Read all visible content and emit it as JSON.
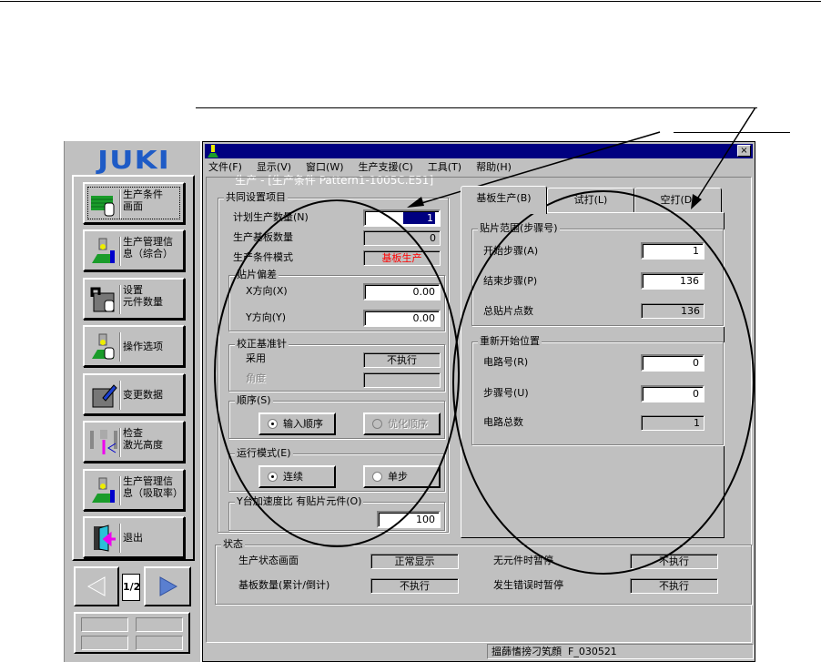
{
  "sidebar": {
    "logo": "JUKI",
    "buttons": [
      {
        "label": "生产条件\n画面",
        "icon": "pcb-hand-icon"
      },
      {
        "label": "生产管理信\n息（综合）",
        "icon": "head-info-icon"
      },
      {
        "label": "设置\n元件数量",
        "icon": "component-count-icon"
      },
      {
        "label": "操作选项",
        "icon": "head-hand-icon"
      },
      {
        "label": "变更数据",
        "icon": "edit-data-icon"
      },
      {
        "label": "检查\n激光高度",
        "icon": "laser-height-icon"
      },
      {
        "label": "生产管理信\n息（吸取率）",
        "icon": "head-info-icon"
      },
      {
        "label": "退出",
        "icon": "exit-door-icon"
      }
    ],
    "page_indicator": "1/2"
  },
  "window": {
    "title": "生产 - [生产条件 Pattern1-1005C.E51]",
    "close": "×",
    "menu": [
      "文件(F)",
      "显示(V)",
      "窗口(W)",
      "生产支援(C)",
      "工具(T)",
      "帮助(H)"
    ]
  },
  "common": {
    "title": "共同设置项目",
    "plan_qty_label": "计划生产数量(N)",
    "plan_qty": "1",
    "board_qty_label": "生产基板数量",
    "board_qty": "0",
    "mode_label": "生产条件模式",
    "mode": "基板生产",
    "offset": {
      "title": "贴片偏差",
      "x_label": "X方向(X)",
      "x": "0.00",
      "y_label": "Y方向(Y)",
      "y": "0.00"
    },
    "pin": {
      "title": "校正基准针",
      "use_label": "采用",
      "use": "不执行",
      "angle_label": "角度",
      "angle": ""
    },
    "order": {
      "title": "顺序(S)",
      "opt1": "输入顺序",
      "opt2": "优化顺序"
    },
    "run": {
      "title": "运行模式(E)",
      "opt1": "连续",
      "opt2": "单步"
    },
    "accel": {
      "title": "Y台加速度比 有贴片元件(O)",
      "value": "100"
    }
  },
  "tabs": [
    "基板生产(B)",
    "试打(L)",
    "空打(D)"
  ],
  "range": {
    "title": "贴片范围(步骤号)",
    "start_label": "开始步骤(A)",
    "start": "1",
    "end_label": "结束步骤(P)",
    "end": "136",
    "total_label": "总贴片点数",
    "total": "136"
  },
  "restart": {
    "title": "重新开始位置",
    "circuit_label": "电路号(R)",
    "circuit": "0",
    "step_label": "步骤号(U)",
    "step": "0",
    "total_label": "电路总数",
    "total": "1"
  },
  "status": {
    "title": "状态",
    "rows": [
      {
        "l1": "生产状态画面",
        "v1": "正常显示",
        "l2": "无元件时暂停",
        "v2": "不执行"
      },
      {
        "l1": "基板数量(累计/倒计)",
        "v1": "不执行",
        "l2": "发生错误时暂停",
        "v2": "不执行"
      }
    ]
  },
  "statusbar": "搵蒒愭搒刁笂顔  F_030521",
  "colors": {
    "titlebar": "#000080",
    "face": "#c0c0c0",
    "mode_text": "#ff0000",
    "logo": "#1e5bc6"
  }
}
